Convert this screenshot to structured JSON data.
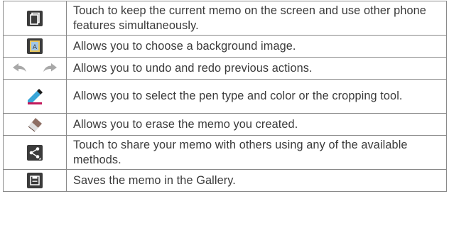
{
  "rows": [
    {
      "icon": "memo-pop-up-window-icon",
      "text": "Touch to keep the current memo on the screen and use other phone features simultaneously."
    },
    {
      "icon": "background-image-icon",
      "text": "Allows you to choose a background image."
    },
    {
      "icon": "undo-redo-arrows-icon",
      "text": "Allows you to undo and redo previous actions."
    },
    {
      "icon": "pen-tool-icon",
      "text": "Allows you to select the pen type and color or the cropping tool."
    },
    {
      "icon": "eraser-icon",
      "text": "Allows you to erase the memo you created."
    },
    {
      "icon": "share-icon",
      "text": "Touch to share your memo with others using any of the available methods."
    },
    {
      "icon": "save-icon",
      "text": "Saves the memo in the Gallery."
    }
  ],
  "colors": {
    "border": "#8a8a8a",
    "text": "#3a3a3a",
    "icon_dark": "#3b3b3b",
    "icon_light": "#ffffff",
    "pen_accent": "#39a6d8",
    "pen_stripe": "#c2185b"
  }
}
